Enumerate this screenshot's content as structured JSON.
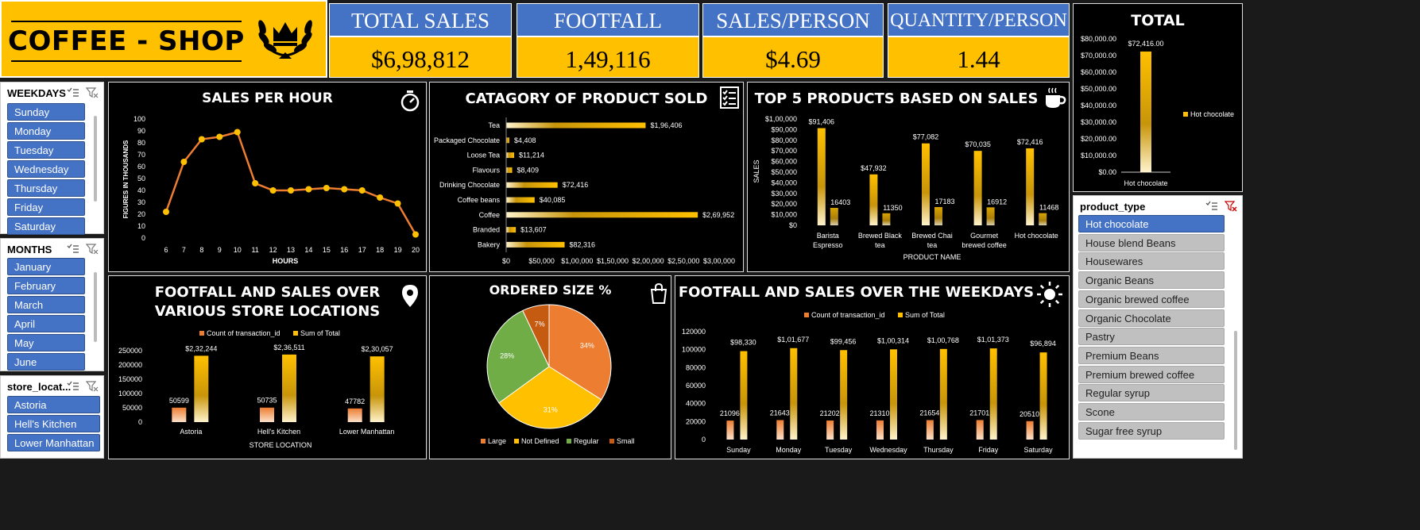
{
  "brand": {
    "title": "COFFEE - SHOP"
  },
  "kpis": [
    {
      "label": "TOTAL SALES",
      "value": "$6,98,812"
    },
    {
      "label": "FOOTFALL",
      "value": "1,49,116"
    },
    {
      "label": "SALES/PERSON",
      "value": "$4.69"
    },
    {
      "label": "QUANTITY/PERSON",
      "value": "1.44"
    }
  ],
  "slicers": {
    "weekdays": {
      "title": "WEEKDAYS",
      "items": [
        "Sunday",
        "Monday",
        "Tuesday",
        "Wednesday",
        "Thursday",
        "Friday",
        "Saturday"
      ]
    },
    "months": {
      "title": "MONTHS",
      "items": [
        "January",
        "February",
        "March",
        "April",
        "May",
        "June"
      ]
    },
    "store": {
      "title": "store_locat...",
      "items": [
        "Astoria",
        "Hell's Kitchen",
        "Lower Manhattan"
      ]
    },
    "product_type": {
      "title": "product_type",
      "selected": "Hot chocolate",
      "items": [
        "Hot chocolate",
        "House blend Beans",
        "Housewares",
        "Organic Beans",
        "Organic brewed coffee",
        "Organic Chocolate",
        "Pastry",
        "Premium Beans",
        "Premium brewed coffee",
        "Regular syrup",
        "Scone",
        "Sugar free syrup"
      ]
    }
  },
  "colors": {
    "orange": "#ed7d31",
    "gold": "#ffc000",
    "blue": "#4472c4",
    "green": "#70ad47",
    "brown": "#c55a11"
  },
  "icons": [
    "crown-laurel-icon",
    "stopwatch-icon",
    "checklist-icon",
    "coffee-cup-icon",
    "location-pin-icon",
    "shopping-bag-icon",
    "sun-icon",
    "multi-select-icon",
    "clear-filter-icon"
  ],
  "chart_data": [
    {
      "id": "sales_per_hour",
      "type": "line",
      "title": "SALES PER HOUR",
      "xlabel": "HOURS",
      "ylabel": "FIGURES IN THOUSANDS",
      "x": [
        6,
        7,
        8,
        9,
        10,
        11,
        12,
        13,
        14,
        15,
        16,
        17,
        18,
        19,
        20
      ],
      "values": [
        22,
        64,
        83,
        85,
        89,
        46,
        40,
        40,
        41,
        42,
        41,
        40,
        34,
        29,
        3
      ],
      "ylim": [
        0,
        100
      ],
      "yticks": [
        "0",
        "10",
        "20",
        "30",
        "40",
        "50",
        "60",
        "70",
        "80",
        "90",
        "100"
      ]
    },
    {
      "id": "category_sold",
      "type": "bar",
      "orientation": "horizontal",
      "title": "CATAGORY OF PRODUCT SOLD",
      "categories": [
        "Tea",
        "Packaged Chocolate",
        "Loose Tea",
        "Flavours",
        "Drinking Chocolate",
        "Coffee beans",
        "Coffee",
        "Branded",
        "Bakery"
      ],
      "values": [
        196406,
        4408,
        11214,
        8409,
        72416,
        40085,
        269952,
        13607,
        82316
      ],
      "labels": [
        "$1,96,406",
        "$4,408",
        "$11,214",
        "$8,409",
        "$72,416",
        "$40,085",
        "$2,69,952",
        "$13,607",
        "$82,316"
      ],
      "xlim": [
        0,
        300000
      ],
      "xticks": [
        "$0",
        "$50,000",
        "$1,00,000",
        "$1,50,000",
        "$2,00,000",
        "$2,50,000",
        "$3,00,000"
      ]
    },
    {
      "id": "top5_products",
      "type": "bar",
      "title": "TOP 5 PRODUCTS BASED ON SALES",
      "xlabel": "PRODUCT NAME",
      "ylabel": "SALES",
      "categories": [
        "Barista Espresso",
        "Brewed Black tea",
        "Brewed Chai tea",
        "Gourmet brewed coffee",
        "Hot chocolate"
      ],
      "category_lines": [
        [
          "Barista",
          "Espresso"
        ],
        [
          "Brewed Black",
          "tea"
        ],
        [
          "Brewed Chai",
          "tea"
        ],
        [
          "Gourmet",
          "brewed coffee"
        ],
        [
          "Hot chocolate"
        ]
      ],
      "series": [
        {
          "values": [
            91406,
            47932,
            77082,
            70035,
            72416
          ],
          "labels": [
            "$91,406",
            "$47,932",
            "$77,082",
            "$70,035",
            "$72,416"
          ]
        },
        {
          "values": [
            16403,
            11350,
            17183,
            16912,
            11468
          ],
          "labels": [
            "16403",
            "11350",
            "17183",
            "16912",
            "11468"
          ]
        }
      ],
      "ylim": [
        0,
        100000
      ],
      "yticks": [
        "$0",
        "$10,000",
        "$20,000",
        "$30,000",
        "$40,000",
        "$50,000",
        "$60,000",
        "$70,000",
        "$80,000",
        "$90,000",
        "$1,00,000"
      ]
    },
    {
      "id": "total",
      "type": "bar",
      "title": "TOTAL",
      "categories": [
        "Hot chocolate"
      ],
      "values": [
        72416
      ],
      "labels": [
        "$72,416.00"
      ],
      "legend": [
        "Hot chocolate"
      ],
      "legend_position": "right",
      "ylim": [
        0,
        80000
      ],
      "yticks": [
        "$0.00",
        "$10,000.00",
        "$20,000.00",
        "$30,000.00",
        "$40,000.00",
        "$50,000.00",
        "$60,000.00",
        "$70,000.00",
        "$80,000.00"
      ]
    },
    {
      "id": "store_locations",
      "type": "bar",
      "title_lines": [
        "FOOTFALL AND SALES OVER",
        "VARIOUS STORE LOCATIONS"
      ],
      "xlabel": "STORE LOCATION",
      "categories": [
        "Astoria",
        "Hell's Kitchen",
        "Lower Manhattan"
      ],
      "series": [
        {
          "name": "Count of transaction_id",
          "values": [
            50599,
            50735,
            47782
          ],
          "labels": [
            "50599",
            "50735",
            "47782"
          ]
        },
        {
          "name": "Sum of Total",
          "values": [
            232244,
            236511,
            230057
          ],
          "labels": [
            "$2,32,244",
            "$2,36,511",
            "$2,30,057"
          ]
        }
      ],
      "ylim": [
        0,
        250000
      ],
      "yticks": [
        "0",
        "50000",
        "100000",
        "150000",
        "200000",
        "250000"
      ],
      "legend_position": "top"
    },
    {
      "id": "ordered_size",
      "type": "pie",
      "title": "ORDERED SIZE %",
      "categories": [
        "Large",
        "Not Defined",
        "Regular",
        "Small"
      ],
      "values": [
        34,
        31,
        28,
        7
      ],
      "labels": [
        "34%",
        "31%",
        "28%",
        "7%"
      ],
      "legend_position": "bottom"
    },
    {
      "id": "weekdays",
      "type": "bar",
      "title": "FOOTFALL AND SALES OVER THE WEEKDAYS",
      "categories": [
        "Sunday",
        "Monday",
        "Tuesday",
        "Wednesday",
        "Thursday",
        "Friday",
        "Saturday"
      ],
      "series": [
        {
          "name": "Count of transaction_id",
          "values": [
            21096,
            21643,
            21202,
            21310,
            21654,
            21701,
            20510
          ],
          "labels": [
            "21096",
            "21643",
            "21202",
            "21310",
            "21654",
            "21701",
            "20510"
          ]
        },
        {
          "name": "Sum of Total",
          "values": [
            98330,
            101677,
            99456,
            100314,
            100768,
            101373,
            96894
          ],
          "labels": [
            "$98,330",
            "$1,01,677",
            "$99,456",
            "$1,00,314",
            "$1,00,768",
            "$1,01,373",
            "$96,894"
          ]
        }
      ],
      "ylim": [
        0,
        120000
      ],
      "yticks": [
        "0",
        "20000",
        "40000",
        "60000",
        "80000",
        "100000",
        "120000"
      ],
      "legend_position": "top"
    }
  ]
}
